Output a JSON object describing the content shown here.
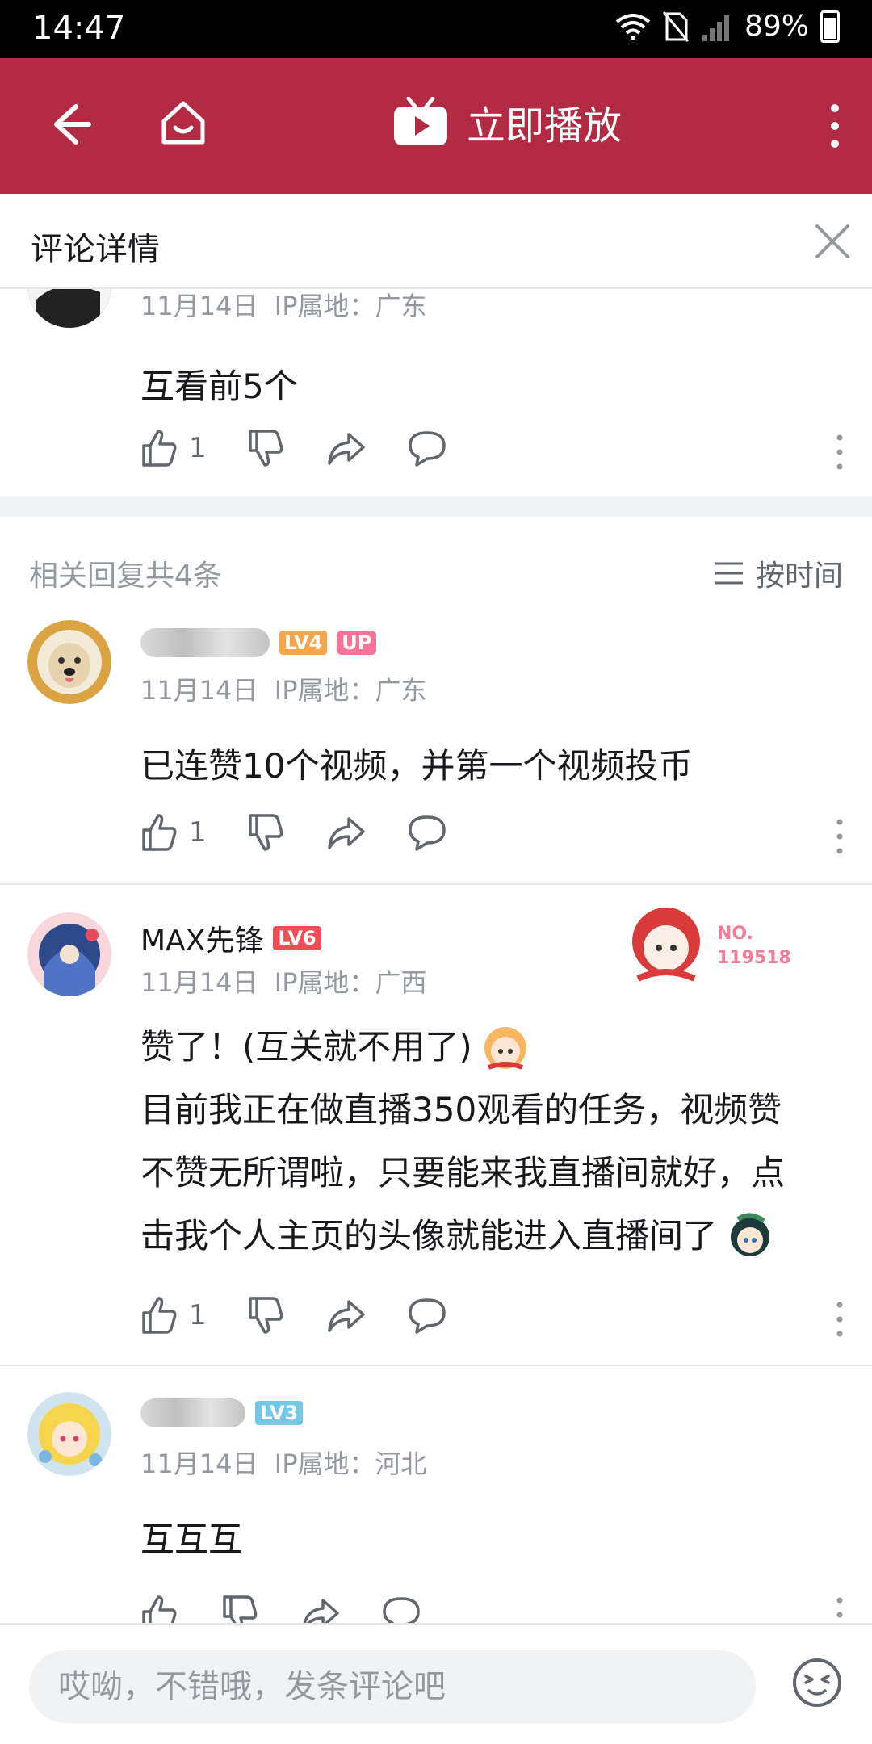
{
  "status_bar": {
    "time": "14:47",
    "battery": "89%"
  },
  "app_bar": {
    "title": "立即播放"
  },
  "detail_header": {
    "title": "评论详情"
  },
  "main_comment": {
    "date": "11月14日",
    "ip": "IP属地：广东",
    "content": "互看前5个",
    "likes": "1"
  },
  "replies_header": {
    "count_text": "相关回复共4条",
    "sort_label": "按时间"
  },
  "replies": [
    {
      "level": "LV4",
      "up_badge": "UP",
      "date": "11月14日",
      "ip": "IP属地：广东",
      "content": "已连赞10个视频，并第一个视频投币",
      "likes": "1"
    },
    {
      "username": "MAX先锋",
      "level": "LV6",
      "badge_no": "NO.",
      "badge_num": "119518",
      "date": "11月14日",
      "ip": "IP属地：广西",
      "content_lines": [
        "赞了！(互关就不用了)",
        "目前我正在做直播350观看的任务，视频赞",
        "不赞无所谓啦，只要能来我直播间就好，点",
        "击我个人主页的头像就能进入直播间了"
      ],
      "likes": "1"
    },
    {
      "level": "LV3",
      "date": "11月14日",
      "ip": "IP属地：河北",
      "content": "互互互"
    }
  ],
  "bottom_bar": {
    "placeholder": "哎呦，不错哦，发条评论吧"
  }
}
